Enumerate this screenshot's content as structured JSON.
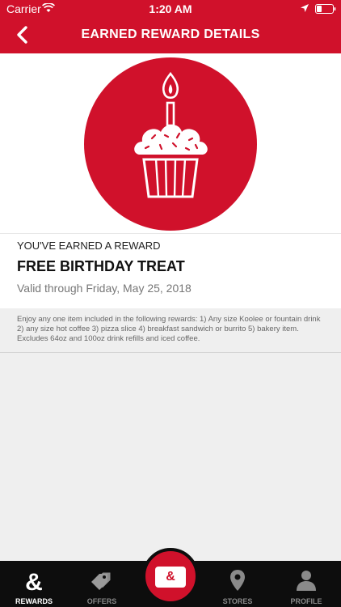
{
  "status_bar": {
    "carrier": "Carrier",
    "time": "1:20 AM"
  },
  "header": {
    "title": "EARNED REWARD DETAILS"
  },
  "reward": {
    "eyebrow": "YOU'VE EARNED A REWARD",
    "title": "FREE BIRTHDAY TREAT",
    "valid_through": "Valid through Friday, May 25, 2018",
    "image_icon": "birthday-cupcake-icon"
  },
  "details": "Enjoy any one item included in the following rewards: 1) Any size Koolee or fountain drink 2) any size hot coffee 3) pizza slice 4) breakfast sandwich or burrito 5) bakery item. Excludes 64oz and 100oz drink refills and iced coffee.",
  "tabbar": {
    "items": [
      {
        "label": "REWARDS",
        "icon": "ampersand-icon",
        "active": true
      },
      {
        "label": "OFFERS",
        "icon": "tag-icon",
        "active": false
      },
      {
        "label": "STORES",
        "icon": "location-pin-icon",
        "active": false
      },
      {
        "label": "PROFILE",
        "icon": "person-icon",
        "active": false
      }
    ],
    "center": {
      "glyph": "&",
      "icon": "card-icon"
    }
  },
  "colors": {
    "brand_red": "#d0112b",
    "tabbar_bg": "#0d0d0d"
  }
}
